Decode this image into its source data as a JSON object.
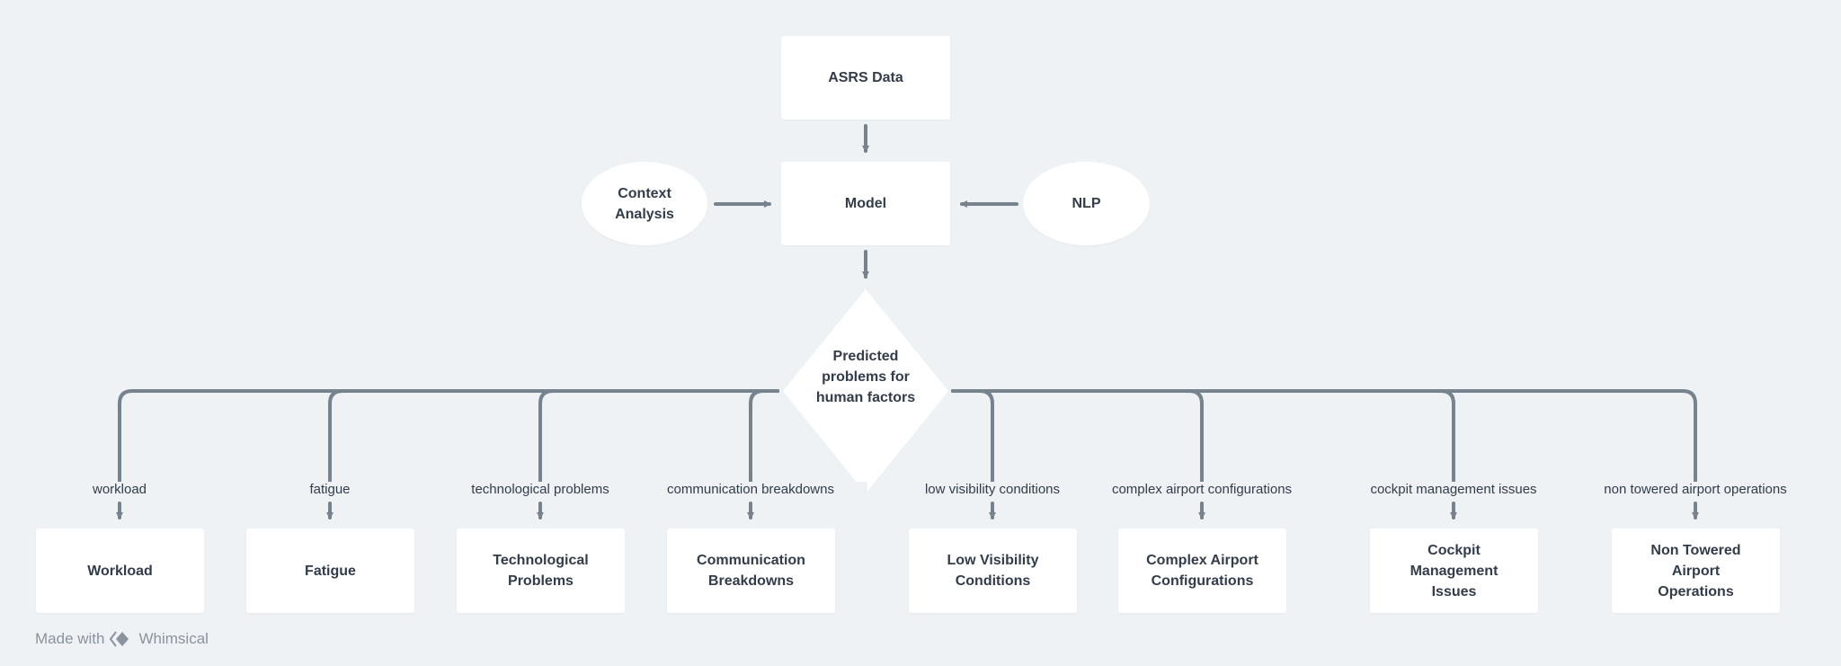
{
  "nodes": {
    "source": "ASRS Data",
    "model": "Model",
    "context": "Context Analysis",
    "nlp": "NLP",
    "decision": "Predicted problems for human factors"
  },
  "branches": [
    {
      "edge": "workload",
      "box": "Workload"
    },
    {
      "edge": "fatigue",
      "box": "Fatigue"
    },
    {
      "edge": "technological problems",
      "box": "Technological Problems"
    },
    {
      "edge": "communication breakdowns",
      "box": "Communication Breakdowns"
    },
    {
      "edge": "low visibility conditions",
      "box": "Low Visibility Conditions"
    },
    {
      "edge": "complex airport configurations",
      "box": "Complex Airport Configurations"
    },
    {
      "edge": "cockpit management issues",
      "box": "Cockpit Management Issues"
    },
    {
      "edge": "non towered airport operations",
      "box": "Non Towered Airport Operations"
    }
  ],
  "footer": {
    "prefix": "Made with",
    "brand": "Whimsical"
  },
  "colors": {
    "background": "#eff2f5",
    "connector": "#76838f",
    "node": "#ffffff",
    "text": "#323c4a"
  }
}
